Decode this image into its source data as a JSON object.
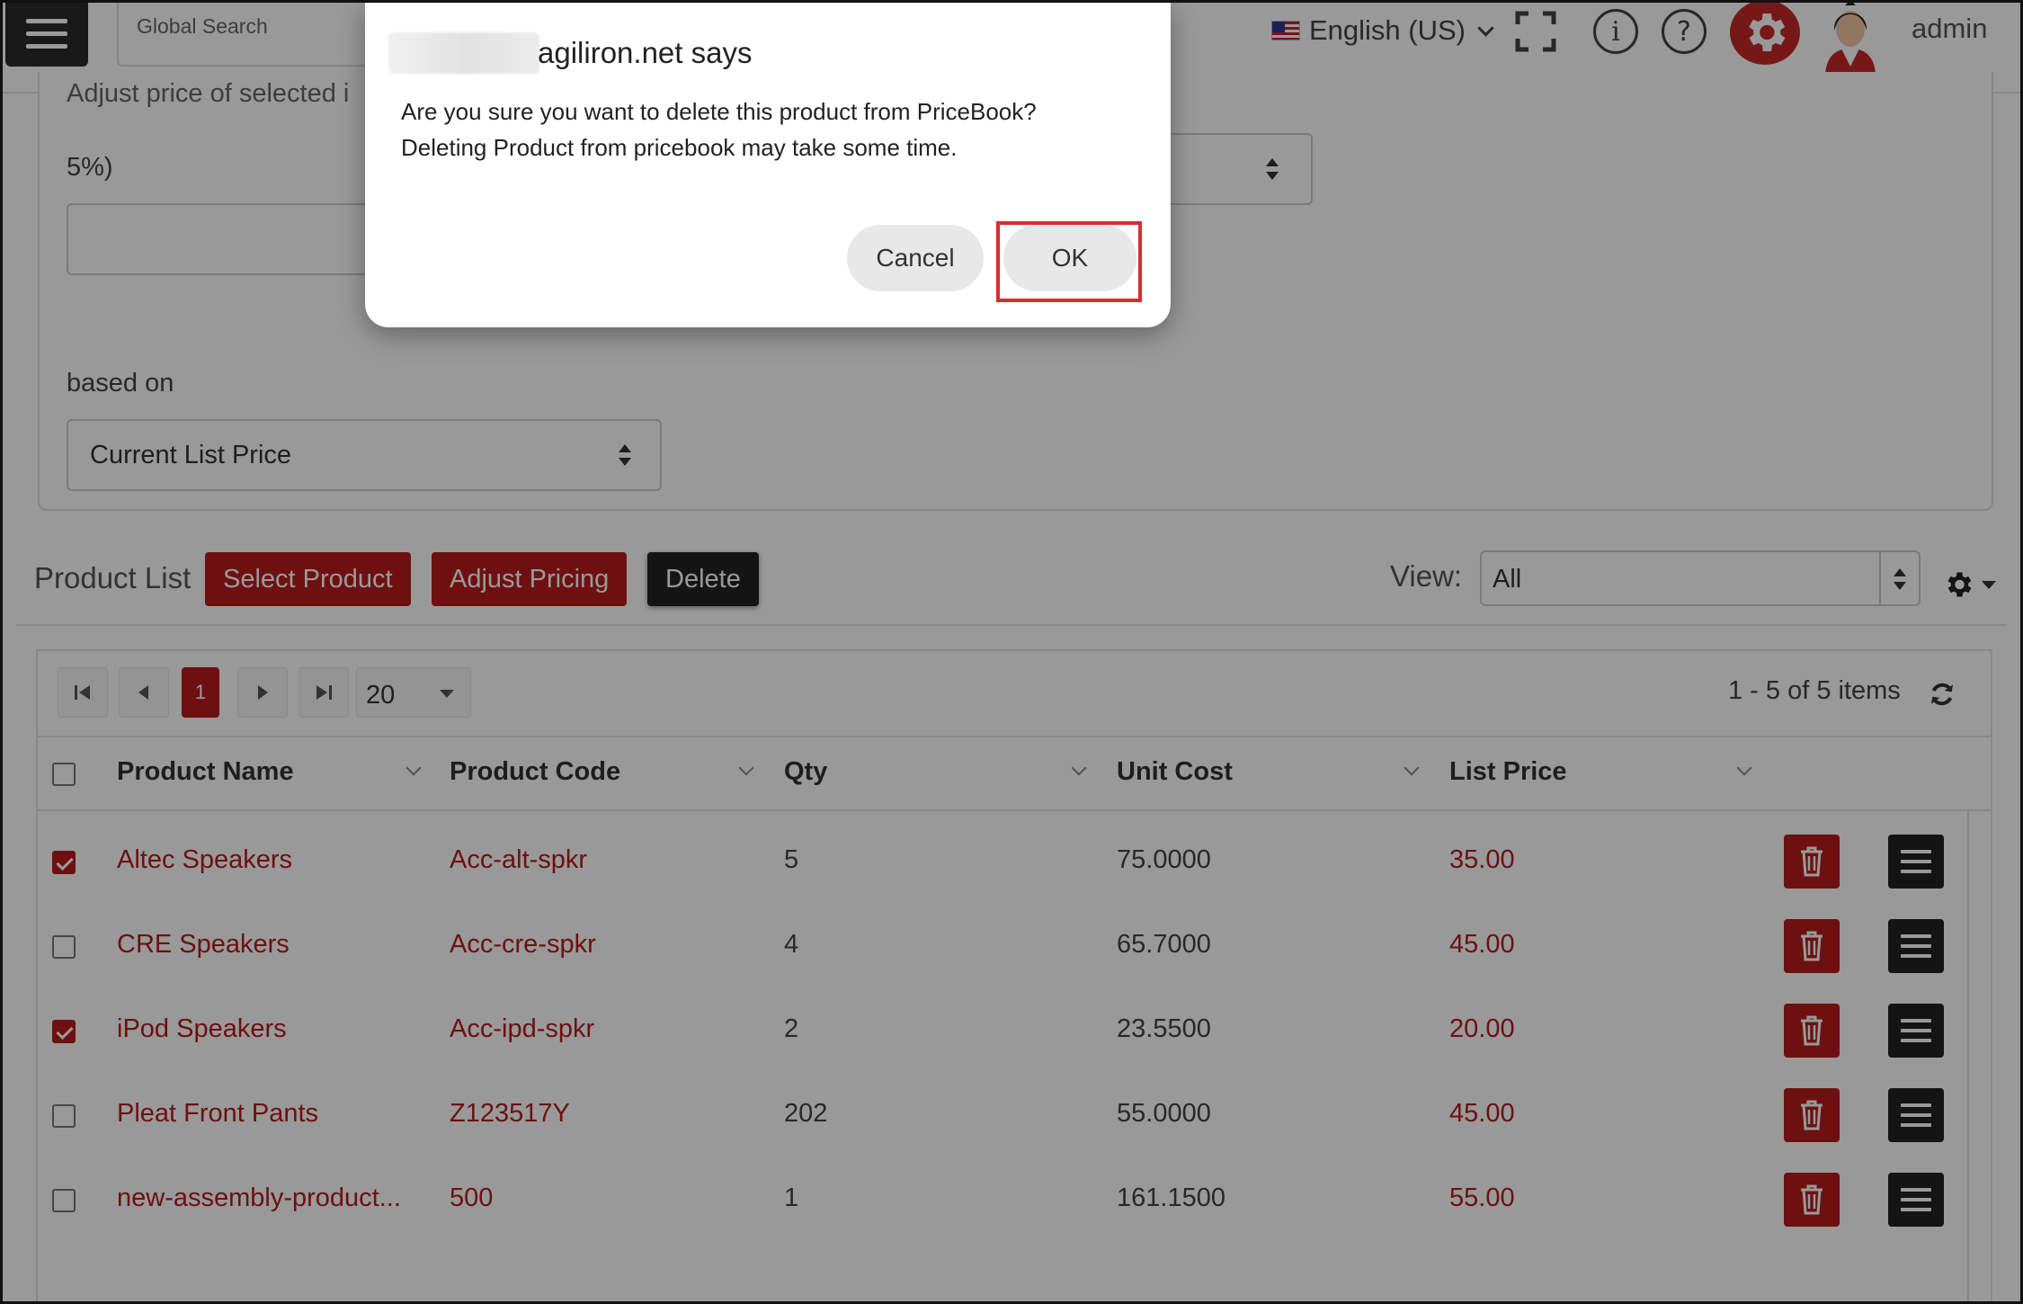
{
  "header": {
    "search_placeholder": "Global Search",
    "language": "English (US)",
    "user": "admin"
  },
  "pricing_form": {
    "clipped_label": "Adjust price of selected i",
    "percent_hint": "5%)",
    "based_on_label": "based on",
    "based_on_value": "Current List Price"
  },
  "product_list": {
    "title": "Product List",
    "select_product_label": "Select Product",
    "adjust_pricing_label": "Adjust Pricing",
    "delete_label": "Delete",
    "view_label": "View:",
    "view_value": "All"
  },
  "pager": {
    "current_page": "1",
    "page_size": "20",
    "info": "1 - 5 of 5 items"
  },
  "columns": [
    "Product Name",
    "Product Code",
    "Qty",
    "Unit Cost",
    "List Price"
  ],
  "rows": [
    {
      "checked": true,
      "name": "Altec Speakers",
      "code": "Acc-alt-spkr",
      "qty": "5",
      "unit_cost": "75.0000",
      "list_price": "35.00"
    },
    {
      "checked": false,
      "name": "CRE Speakers",
      "code": "Acc-cre-spkr",
      "qty": "4",
      "unit_cost": "65.7000",
      "list_price": "45.00"
    },
    {
      "checked": true,
      "name": "iPod Speakers",
      "code": "Acc-ipd-spkr",
      "qty": "2",
      "unit_cost": "23.5500",
      "list_price": "20.00"
    },
    {
      "checked": false,
      "name": "Pleat Front Pants",
      "code": "Z123517Y",
      "qty": "202",
      "unit_cost": "55.0000",
      "list_price": "45.00"
    },
    {
      "checked": false,
      "name": "new-assembly-product...",
      "code": "500",
      "qty": "1",
      "unit_cost": "161.1500",
      "list_price": "55.00"
    }
  ],
  "dialog": {
    "title": "agiliron.net says",
    "message_line1": "Are you sure you want to delete this product from PriceBook?",
    "message_line2": "Deleting Product from pricebook may take some time.",
    "cancel_label": "Cancel",
    "ok_label": "OK"
  },
  "colors": {
    "accent_red": "#b71c1c",
    "dark_button": "#222222",
    "highlight_box": "#d32f2f"
  },
  "icons": [
    "menu-icon",
    "flag-us-icon",
    "chevron-down-icon",
    "fullscreen-icon",
    "info-icon",
    "help-icon",
    "gear-icon",
    "avatar",
    "first-page-icon",
    "prev-page-icon",
    "next-page-icon",
    "last-page-icon",
    "refresh-icon",
    "trash-icon",
    "row-menu-icon"
  ]
}
